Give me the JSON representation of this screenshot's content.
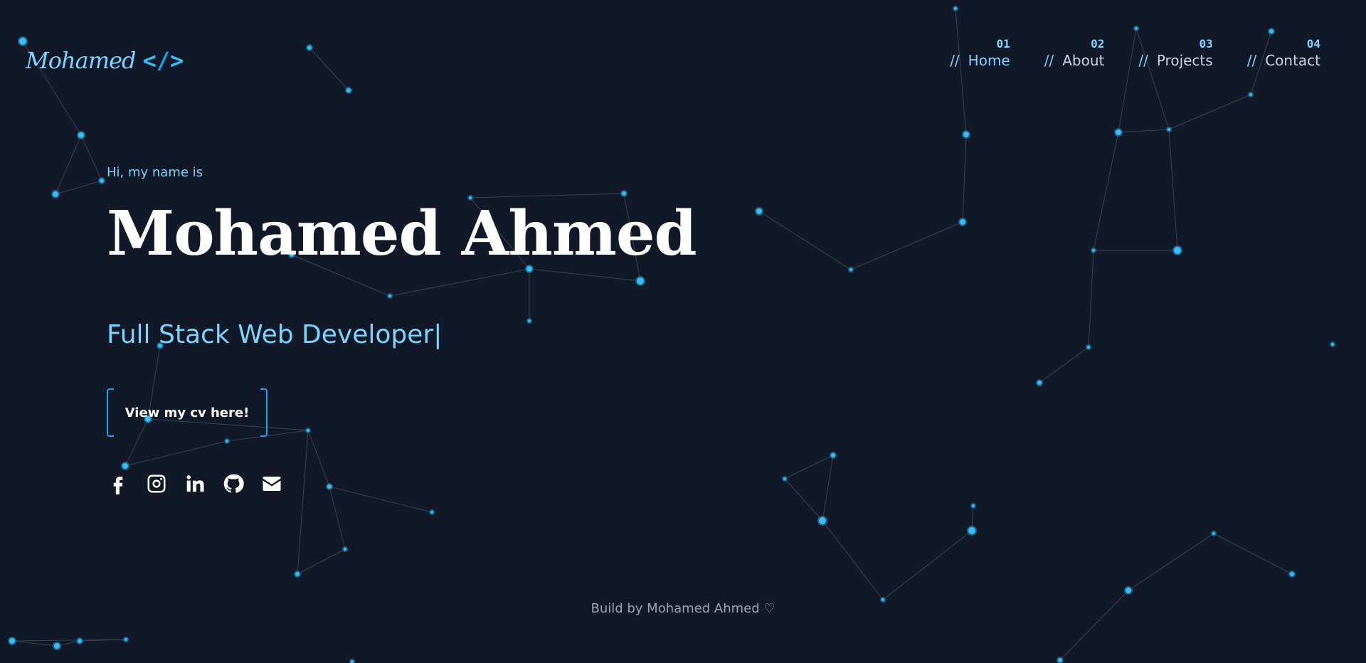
{
  "logo": {
    "text": "Mohamed",
    "code_open": "<",
    "code_slash": "/",
    "code_close": ">"
  },
  "nav": {
    "items": [
      {
        "num": "01",
        "sep": "//",
        "label": "Home"
      },
      {
        "num": "02",
        "sep": "//",
        "label": "About"
      },
      {
        "num": "03",
        "sep": "//",
        "label": "Projects"
      },
      {
        "num": "04",
        "sep": "//",
        "label": "Contact"
      }
    ]
  },
  "hero": {
    "intro": "Hi, my name is",
    "name": "Mohamed Ahmed",
    "role": "Full Stack Web Developer",
    "cursor": "|",
    "cv_button": "View my cv here!"
  },
  "social": {
    "icons": [
      "facebook-icon",
      "instagram-icon",
      "linkedin-icon",
      "github-icon",
      "email-icon"
    ]
  },
  "footer": {
    "text": "Build by Mohamed Ahmed ♡"
  },
  "colors": {
    "background": "#111827",
    "accent": "#7dd3fc",
    "accent_dark": "#0ea5e9",
    "muted": "#9ca3af"
  }
}
